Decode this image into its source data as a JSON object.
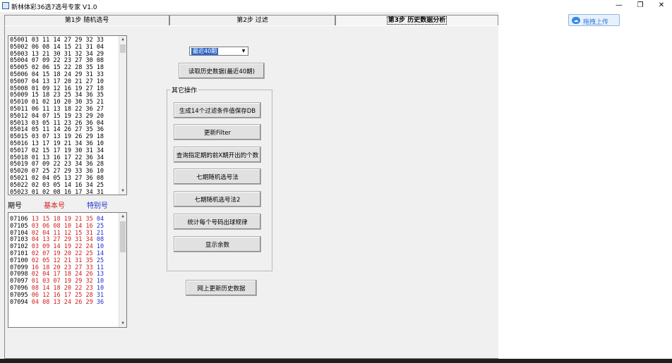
{
  "window": {
    "title": "新林体彩36选7选号专家 V1.0",
    "minimize": "—",
    "restore": "❐",
    "close": "✕"
  },
  "tabs": [
    {
      "label": "第1步 随机选号"
    },
    {
      "label": "第2步 过滤"
    },
    {
      "label": "第3步 历史数据分析"
    }
  ],
  "history_list": [
    "05001 03 11 14 27 29 32 33",
    "05002 06 08 14 15 21 31 04",
    "05003 13 21 30 31 32 34 29",
    "05004 07 09 22 23 27 30 08",
    "05005 02 06 15 22 28 35 18",
    "05006 04 15 18 24 29 31 33",
    "05007 04 13 17 20 21 27 10",
    "05008 01 09 12 16 19 27 18",
    "05009 15 18 23 25 34 36 35",
    "05010 01 02 10 20 30 35 21",
    "05011 06 11 13 18 22 36 27",
    "05012 04 07 15 19 23 29 20",
    "05013 03 05 11 23 26 36 04",
    "05014 05 11 14 26 27 35 36",
    "05015 03 07 13 19 26 29 18",
    "05016 13 17 19 21 34 36 10",
    "05017 02 15 17 19 30 31 34",
    "05018 01 13 16 17 22 36 34",
    "05019 07 09 22 23 34 36 28",
    "05020 07 25 27 29 33 36 10",
    "05021 02 04 05 13 27 36 08",
    "05022 02 03 05 14 16 34 25",
    "05023 01 02 08 16 17 34 31"
  ],
  "headers": {
    "period": "期号",
    "basic": "基本号",
    "special": "特别号"
  },
  "draws": [
    {
      "period": "07106",
      "basic": "13 15 18 19 21 35",
      "special": "04"
    },
    {
      "period": "07105",
      "basic": "03 06 08 10 14 16",
      "special": "25"
    },
    {
      "period": "07104",
      "basic": "02 04 11 12 15 31",
      "special": "21"
    },
    {
      "period": "07103",
      "basic": "04 13 27 29 31 34",
      "special": "08"
    },
    {
      "period": "07102",
      "basic": "03 09 14 19 22 24",
      "special": "10"
    },
    {
      "period": "07101",
      "basic": "02 07 19 20 22 25",
      "special": "14"
    },
    {
      "period": "07100",
      "basic": "02 05 12 21 31 35",
      "special": "25"
    },
    {
      "period": "07099",
      "basic": "16 18 20 23 27 33",
      "special": "11"
    },
    {
      "period": "07098",
      "basic": "02 04 17 18 24 26",
      "special": "13"
    },
    {
      "period": "07097",
      "basic": "01 03 07 19 29 32",
      "special": "10"
    },
    {
      "period": "07096",
      "basic": "08 14 18 20 22 23",
      "special": "10"
    },
    {
      "period": "07095",
      "basic": "06 12 16 17 25 28",
      "special": "31"
    },
    {
      "period": "07094",
      "basic": "04 08 13 24 26 29",
      "special": "36"
    }
  ],
  "combo": {
    "selected": "最近40期"
  },
  "buttons": {
    "read_history": "读取历史数据(最近40期)",
    "group_title": "其它操作",
    "gen14": "生成14个过滤条件值保存DB",
    "update_filter": "更新Filter",
    "query_n": "查询指定期的前X期开出的个数",
    "seven_random": "七期随机选号法",
    "seven_random2": "七期随机选号法2",
    "stat_each": "统计每个号码出球规律",
    "show_remainder": "显示余数",
    "online_update": "网上更新历史数据"
  },
  "upload": {
    "label": "拖拽上传"
  }
}
